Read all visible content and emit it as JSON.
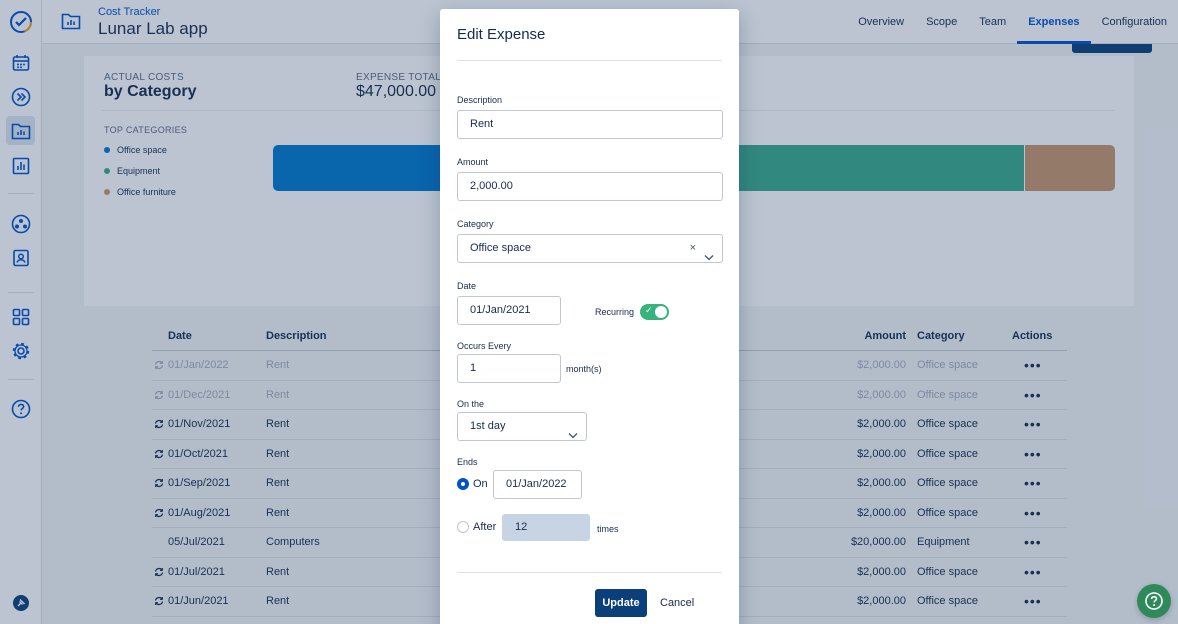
{
  "header": {
    "app_subtitle": "Cost Tracker",
    "app_title": "Lunar Lab app",
    "nav": [
      {
        "label": "Overview"
      },
      {
        "label": "Scope"
      },
      {
        "label": "Team"
      },
      {
        "label": "Expenses"
      },
      {
        "label": "Configuration"
      }
    ]
  },
  "summary": {
    "actual_costs_caption": "ACTUAL COSTS",
    "by_category": "by Category",
    "expense_total_caption": "EXPENSE TOTAL",
    "expense_total_value": "$47,000.00",
    "top_categories_caption": "TOP CATEGORIES",
    "legend": [
      {
        "label": "Office space",
        "color": "#0077cc"
      },
      {
        "label": "Equipment",
        "color": "#3aa98a"
      },
      {
        "label": "Office furniture",
        "color": "#c8956a"
      }
    ]
  },
  "table": {
    "headers": {
      "date": "Date",
      "description": "Description",
      "amount": "Amount",
      "category": "Category",
      "actions": "Actions"
    },
    "rows": [
      {
        "date": "01/Jan/2022",
        "description": "Rent",
        "amount": "$2,000.00",
        "category": "Office space",
        "actions": "•••"
      },
      {
        "date": "01/Dec/2021",
        "description": "Rent",
        "amount": "$2,000.00",
        "category": "Office space",
        "actions": "•••"
      },
      {
        "date": "01/Nov/2021",
        "description": "Rent",
        "amount": "$2,000.00",
        "category": "Office space",
        "actions": "•••"
      },
      {
        "date": "01/Oct/2021",
        "description": "Rent",
        "amount": "$2,000.00",
        "category": "Office space",
        "actions": "•••"
      },
      {
        "date": "01/Sep/2021",
        "description": "Rent",
        "amount": "$2,000.00",
        "category": "Office space",
        "actions": "•••"
      },
      {
        "date": "01/Aug/2021",
        "description": "Rent",
        "amount": "$2,000.00",
        "category": "Office space",
        "actions": "•••"
      },
      {
        "date": "05/Jul/2021",
        "description": "Computers",
        "amount": "$20,000.00",
        "category": "Equipment",
        "actions": "•••"
      },
      {
        "date": "01/Jul/2021",
        "description": "Rent",
        "amount": "$2,000.00",
        "category": "Office space",
        "actions": "•••"
      },
      {
        "date": "01/Jun/2021",
        "description": "Rent",
        "amount": "$2,000.00",
        "category": "Office space",
        "actions": "•••"
      }
    ]
  },
  "modal": {
    "title": "Edit Expense",
    "description_label": "Description",
    "description_value": "Rent",
    "amount_label": "Amount",
    "amount_value": "2,000.00",
    "category_label": "Category",
    "category_value": "Office space",
    "clear_glyph": "×",
    "date_label": "Date",
    "date_value": "01/Jan/2021",
    "recurring_label": "Recurring",
    "recurring_on": true,
    "occurs_every_label": "Occurs Every",
    "occurs_every_value": "1",
    "occurs_every_unit": "month(s)",
    "on_the_label": "On the",
    "on_the_value": "1st day",
    "ends_label": "Ends",
    "ends_on_label": "On",
    "ends_on_value": "01/Jan/2022",
    "ends_after_label": "After",
    "ends_after_value": "12",
    "ends_after_unit": "times",
    "update_label": "Update",
    "cancel_label": "Cancel"
  },
  "colors": {
    "primary": "#0052cc",
    "dark_button": "#0a3f7a",
    "toggle_on": "#36b37e",
    "help_fab": "#2e8a5a"
  }
}
